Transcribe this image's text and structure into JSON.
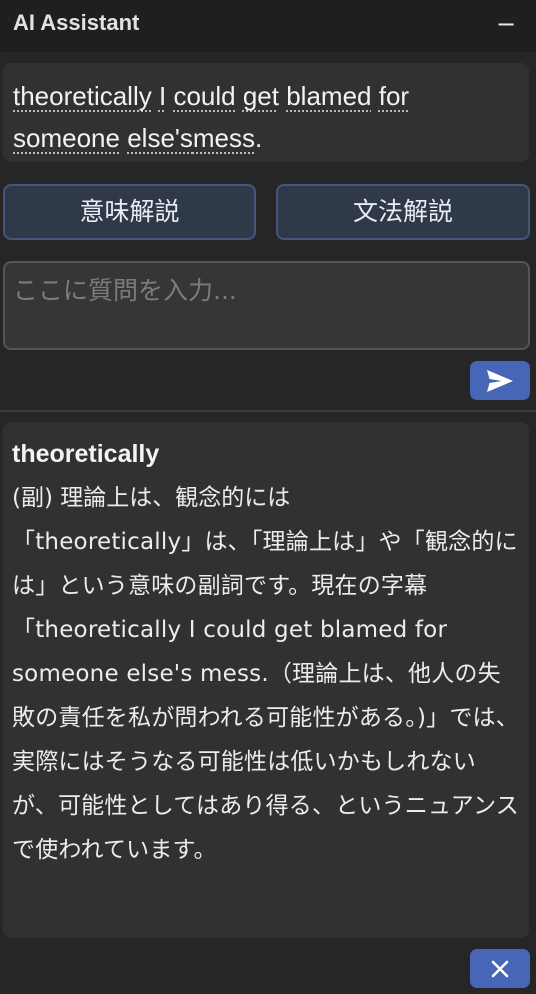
{
  "header": {
    "title": "AI Assistant",
    "minimize_icon": "minus-icon"
  },
  "sentence": {
    "words": [
      "theoretically",
      "I",
      "could",
      "get",
      "blamed",
      "for",
      "someone",
      "else's",
      "mess"
    ],
    "trailing": "."
  },
  "buttons": {
    "meaning": "意味解説",
    "grammar": "文法解説"
  },
  "question": {
    "placeholder": "ここに質問を入力...",
    "value": ""
  },
  "send_icon": "send-arrow-icon",
  "answer": {
    "word": "theoretically",
    "pos_line": "(副) 理論上は、観念的には",
    "body": "「theoretically」は、「理論上は」や「観念的には」という意味の副詞です。現在の字幕「theoretically I could get blamed for someone else's mess.（理論上は、他人の失敗の責任を私が問われる可能性がある。)」では、実際にはそうなる可能性は低いかもしれないが、可能性としてはあり得る、というニュアンスで使われています。"
  },
  "close_icon": "close-icon",
  "colors": {
    "accent": "#4766b6",
    "background": "#262626",
    "panel": "#313131"
  }
}
